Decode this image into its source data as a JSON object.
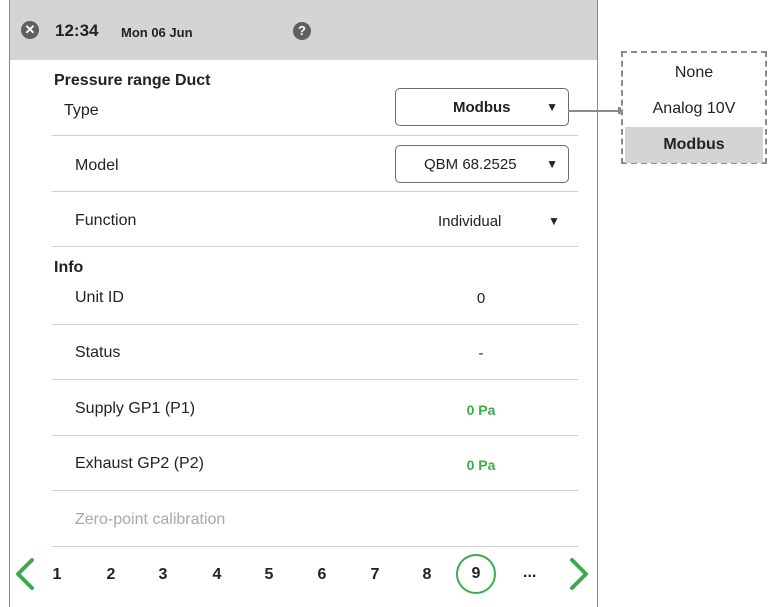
{
  "header": {
    "close_icon": "close-icon",
    "time": "12:34",
    "date": "Mon 06 Jun",
    "help_icon": "help-icon"
  },
  "pressure": {
    "title": "Pressure range Duct",
    "type_label": "Type",
    "type_value": "Modbus",
    "model_label": "Model",
    "model_value": "QBM 68.2525",
    "function_label": "Function",
    "function_value": "Individual"
  },
  "info": {
    "title": "Info",
    "unit_id_label": "Unit ID",
    "unit_id_value": "0",
    "status_label": "Status",
    "status_value": "-",
    "supply_label": "Supply GP1 (P1)",
    "supply_value": "0 Pa",
    "exhaust_label": "Exhaust GP2 (P2)",
    "exhaust_value": "0 Pa",
    "zero_point_label": "Zero-point calibration"
  },
  "pager": {
    "pages": [
      "1",
      "2",
      "3",
      "4",
      "5",
      "6",
      "7",
      "8",
      "9"
    ],
    "current": "9",
    "ellipsis": "...",
    "accent_color": "#3daa4d"
  },
  "type_dropdown": {
    "options": [
      "None",
      "Analog 10V",
      "Modbus"
    ],
    "selected": "Modbus"
  },
  "arrow_glyph": "▼"
}
